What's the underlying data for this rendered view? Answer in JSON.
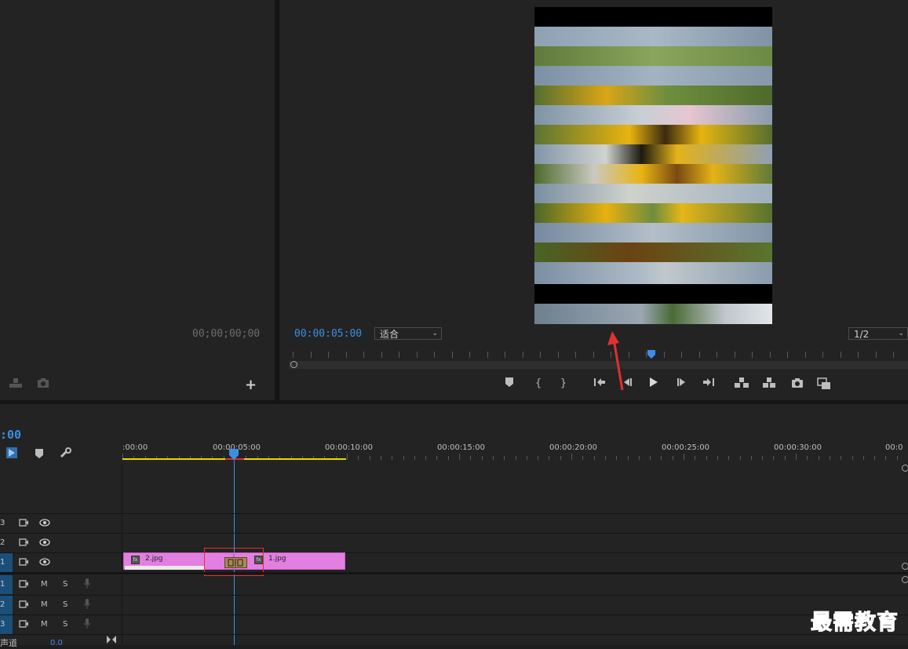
{
  "source": {
    "timecode": "00;00;00;00"
  },
  "program": {
    "timecode": "00:00:05:00",
    "fit_label": "适合",
    "resolution_label": "1/2"
  },
  "timeline": {
    "current_time": ":00",
    "ruler_labels": [
      ":00:00",
      "00:00:05:00",
      "00:00:10:00",
      "00:00:15:00",
      "00:00:20:00",
      "00:00:25:00",
      "00:00:30:00",
      "00:0"
    ],
    "video_tracks": [
      {
        "num": "3",
        "active": false
      },
      {
        "num": "2",
        "active": false
      },
      {
        "num": "1",
        "active": true
      }
    ],
    "audio_tracks": [
      {
        "num": "1",
        "m": "M",
        "s": "S"
      },
      {
        "num": "2",
        "m": "M",
        "s": "S"
      },
      {
        "num": "3",
        "m": "M",
        "s": "S"
      }
    ],
    "master": {
      "label": "声道",
      "value": "0.0"
    },
    "clips": [
      {
        "name": "2.jpg",
        "fx": "fx"
      },
      {
        "name": "1.jpg",
        "fx": "fx"
      }
    ]
  },
  "watermark": "最需教育",
  "colors": {
    "accent_blue": "#3a8ee6",
    "clip_pink": "#e37fe0",
    "work_area_yellow": "#e8d800",
    "highlight_red": "#e03030"
  }
}
